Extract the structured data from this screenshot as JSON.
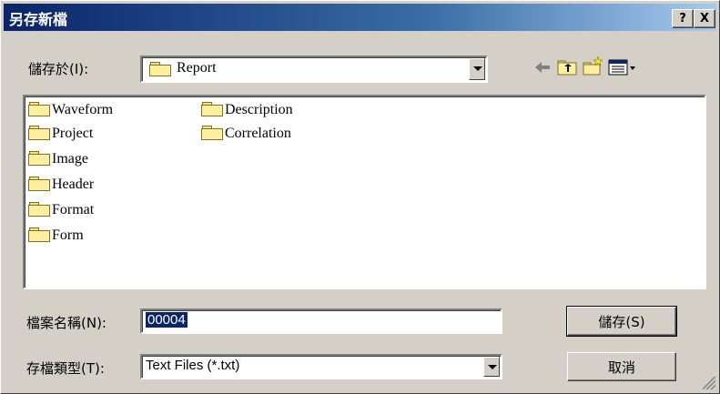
{
  "window": {
    "title": "另存新檔",
    "help_label": "?",
    "close_label": "X"
  },
  "location": {
    "label": "儲存於(I):",
    "value": "Report"
  },
  "folders": [
    {
      "name": "Waveform"
    },
    {
      "name": "Project"
    },
    {
      "name": "Image"
    },
    {
      "name": "Header"
    },
    {
      "name": "Format"
    },
    {
      "name": "Form"
    },
    {
      "name": "Description"
    },
    {
      "name": "Correlation"
    }
  ],
  "filename": {
    "label": "檔案名稱(N):",
    "value": "00004"
  },
  "filetype": {
    "label": "存檔類型(T):",
    "value": "Text Files (*.txt)"
  },
  "buttons": {
    "save": "儲存(S)",
    "cancel": "取消"
  },
  "toolbar": {
    "icons": [
      "back-arrow-icon",
      "up-folder-icon",
      "new-folder-icon",
      "view-menu-icon"
    ]
  }
}
